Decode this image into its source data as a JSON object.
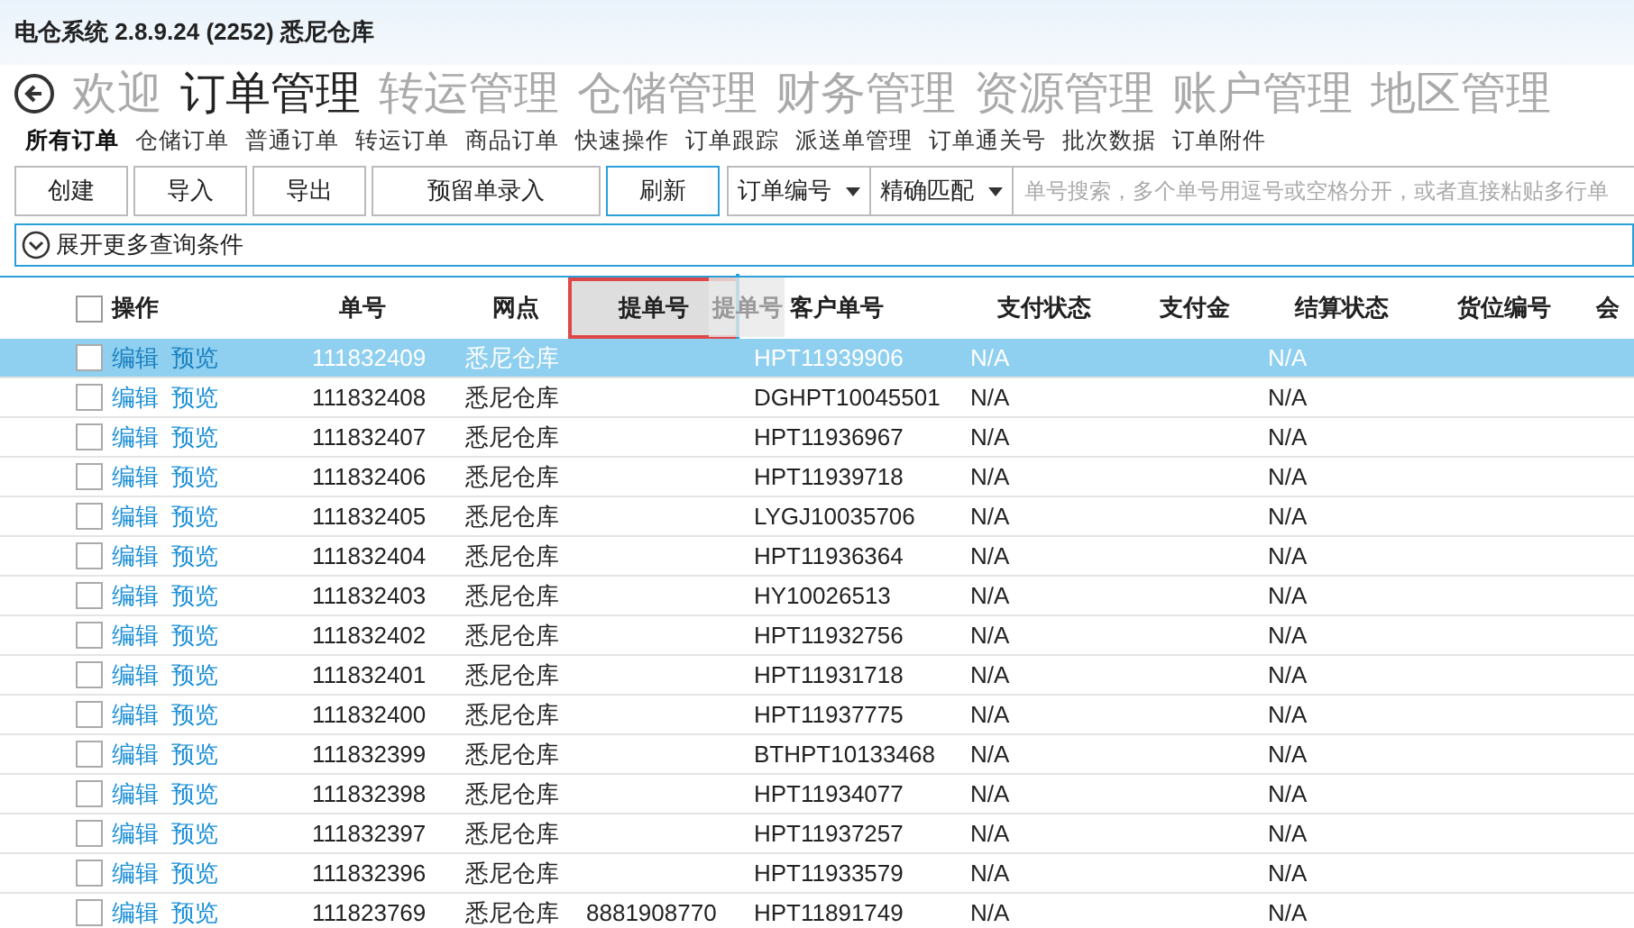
{
  "window": {
    "title": "电仓系统 2.8.9.24 (2252) 悉尼仓库"
  },
  "nav": [
    {
      "label": "欢迎",
      "selected": false
    },
    {
      "label": "订单管理",
      "selected": true
    },
    {
      "label": "转运管理",
      "selected": false
    },
    {
      "label": "仓储管理",
      "selected": false
    },
    {
      "label": "财务管理",
      "selected": false
    },
    {
      "label": "资源管理",
      "selected": false
    },
    {
      "label": "账户管理",
      "selected": false
    },
    {
      "label": "地区管理",
      "selected": false
    }
  ],
  "subnav": [
    {
      "label": "所有订单",
      "selected": true
    },
    {
      "label": "仓储订单",
      "selected": false
    },
    {
      "label": "普通订单",
      "selected": false
    },
    {
      "label": "转运订单",
      "selected": false
    },
    {
      "label": "商品订单",
      "selected": false
    },
    {
      "label": "快速操作",
      "selected": false
    },
    {
      "label": "订单跟踪",
      "selected": false
    },
    {
      "label": "派送单管理",
      "selected": false
    },
    {
      "label": "订单通关号",
      "selected": false
    },
    {
      "label": "批次数据",
      "selected": false
    },
    {
      "label": "订单附件",
      "selected": false
    }
  ],
  "toolbar": {
    "buttons": [
      {
        "label": "创建",
        "selected": false
      },
      {
        "label": "导入",
        "selected": false
      },
      {
        "label": "导出",
        "selected": false
      },
      {
        "label": "预留单录入",
        "selected": false
      },
      {
        "label": "刷新",
        "selected": true
      }
    ],
    "field_select": "订单编号",
    "match_select": "精确匹配",
    "search": {
      "placeholder": "单号搜索，多个单号用逗号或空格分开，或者直接粘贴多行单"
    }
  },
  "expand": {
    "label": "展开更多查询条件"
  },
  "table": {
    "header_checked": false,
    "columns": [
      {
        "label": "操作",
        "dragging": false
      },
      {
        "label": "单号",
        "dragging": false
      },
      {
        "label": "网点",
        "dragging": false
      },
      {
        "label": "提单号",
        "dragging": true
      },
      {
        "label": "客户单号",
        "dragging": false
      },
      {
        "label": "支付状态",
        "dragging": false
      },
      {
        "label": "支付金",
        "dragging": false
      },
      {
        "label": "结算状态",
        "dragging": false
      },
      {
        "label": "货位编号",
        "dragging": false
      },
      {
        "label": "会",
        "dragging": false
      }
    ],
    "drag_ghost": "提单号",
    "rows": [
      {
        "selected": true,
        "checked": false,
        "actions": [
          "编辑",
          "预览"
        ],
        "cells": [
          "",
          "111832409",
          "悉尼仓库",
          "",
          "HPT11939906",
          "N/A",
          "",
          "N/A",
          "",
          ""
        ]
      },
      {
        "selected": false,
        "checked": false,
        "actions": [
          "编辑",
          "预览"
        ],
        "cells": [
          "",
          "111832408",
          "悉尼仓库",
          "",
          "DGHPT10045501",
          "N/A",
          "",
          "N/A",
          "",
          ""
        ]
      },
      {
        "selected": false,
        "checked": false,
        "actions": [
          "编辑",
          "预览"
        ],
        "cells": [
          "",
          "111832407",
          "悉尼仓库",
          "",
          "HPT11936967",
          "N/A",
          "",
          "N/A",
          "",
          ""
        ]
      },
      {
        "selected": false,
        "checked": false,
        "actions": [
          "编辑",
          "预览"
        ],
        "cells": [
          "",
          "111832406",
          "悉尼仓库",
          "",
          "HPT11939718",
          "N/A",
          "",
          "N/A",
          "",
          ""
        ]
      },
      {
        "selected": false,
        "checked": false,
        "actions": [
          "编辑",
          "预览"
        ],
        "cells": [
          "",
          "111832405",
          "悉尼仓库",
          "",
          "LYGJ10035706",
          "N/A",
          "",
          "N/A",
          "",
          ""
        ]
      },
      {
        "selected": false,
        "checked": false,
        "actions": [
          "编辑",
          "预览"
        ],
        "cells": [
          "",
          "111832404",
          "悉尼仓库",
          "",
          "HPT11936364",
          "N/A",
          "",
          "N/A",
          "",
          ""
        ]
      },
      {
        "selected": false,
        "checked": false,
        "actions": [
          "编辑",
          "预览"
        ],
        "cells": [
          "",
          "111832403",
          "悉尼仓库",
          "",
          "HY10026513",
          "N/A",
          "",
          "N/A",
          "",
          ""
        ]
      },
      {
        "selected": false,
        "checked": false,
        "actions": [
          "编辑",
          "预览"
        ],
        "cells": [
          "",
          "111832402",
          "悉尼仓库",
          "",
          "HPT11932756",
          "N/A",
          "",
          "N/A",
          "",
          ""
        ]
      },
      {
        "selected": false,
        "checked": false,
        "actions": [
          "编辑",
          "预览"
        ],
        "cells": [
          "",
          "111832401",
          "悉尼仓库",
          "",
          "HPT11931718",
          "N/A",
          "",
          "N/A",
          "",
          ""
        ]
      },
      {
        "selected": false,
        "checked": false,
        "actions": [
          "编辑",
          "预览"
        ],
        "cells": [
          "",
          "111832400",
          "悉尼仓库",
          "",
          "HPT11937775",
          "N/A",
          "",
          "N/A",
          "",
          ""
        ]
      },
      {
        "selected": false,
        "checked": false,
        "actions": [
          "编辑",
          "预览"
        ],
        "cells": [
          "",
          "111832399",
          "悉尼仓库",
          "",
          "BTHPT10133468",
          "N/A",
          "",
          "N/A",
          "",
          ""
        ]
      },
      {
        "selected": false,
        "checked": false,
        "actions": [
          "编辑",
          "预览"
        ],
        "cells": [
          "",
          "111832398",
          "悉尼仓库",
          "",
          "HPT11934077",
          "N/A",
          "",
          "N/A",
          "",
          ""
        ]
      },
      {
        "selected": false,
        "checked": false,
        "actions": [
          "编辑",
          "预览"
        ],
        "cells": [
          "",
          "111832397",
          "悉尼仓库",
          "",
          "HPT11937257",
          "N/A",
          "",
          "N/A",
          "",
          ""
        ]
      },
      {
        "selected": false,
        "checked": false,
        "actions": [
          "编辑",
          "预览"
        ],
        "cells": [
          "",
          "111832396",
          "悉尼仓库",
          "",
          "HPT11933579",
          "N/A",
          "",
          "N/A",
          "",
          ""
        ]
      },
      {
        "selected": false,
        "checked": false,
        "actions": [
          "编辑",
          "预览"
        ],
        "cells": [
          "",
          "111823769",
          "悉尼仓库",
          "8881908770",
          "HPT11891749",
          "N/A",
          "",
          "N/A",
          "",
          ""
        ]
      }
    ]
  }
}
